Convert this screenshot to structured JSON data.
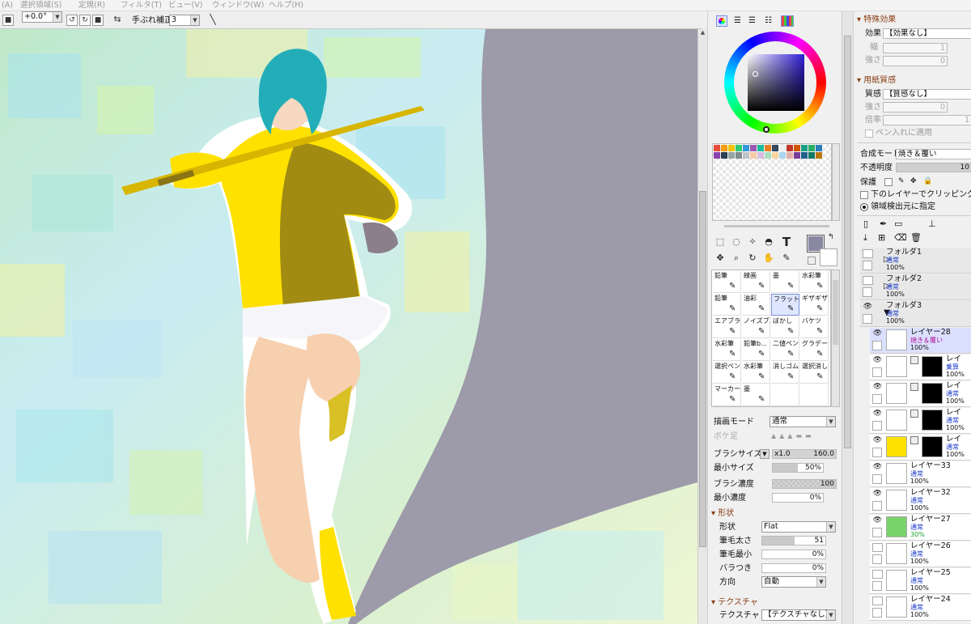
{
  "menu": [
    "(A)",
    "選択領域(S)",
    "定規(R)",
    "フィルタ(T)",
    "ビュー(V)",
    "ウィンドウ(W)",
    "ヘルプ(H)"
  ],
  "toolbar": {
    "angle": "+0.0°",
    "stabilizer_label": "手ぶれ補正",
    "stabilizer_value": "3"
  },
  "color_panel": {
    "palette_colors": [
      "#e74c3c",
      "#f39c12",
      "#f1c40f",
      "#2ecc71",
      "#3498db",
      "#9b59b6",
      "#1abc9c",
      "#e67e22",
      "#34495e",
      "#ecf0f1",
      "#c0392b",
      "#d35400",
      "#16a085",
      "#27ae60",
      "#2980b9",
      "#8e44ad",
      "#2c3e50",
      "#95a5a6",
      "#7f8c8d",
      "#bdc3c7",
      "#f5cba7",
      "#d7bde2",
      "#a9dfbf",
      "#fad7a0",
      "#aed6f1",
      "#e6b0aa",
      "#7d3c98",
      "#1f618d",
      "#117a65",
      "#b9770e"
    ],
    "current_color": "#8a87a3",
    "hue_color": "#2f1dd6"
  },
  "brushes": [
    [
      "鉛筆",
      "線画",
      "墨",
      "水彩筆"
    ],
    [
      "鉛筆",
      "油彩",
      "フラット系",
      "ギザギザ"
    ],
    [
      "エアブラシ",
      "ノイズブ...",
      "ぼかし",
      "バケツ"
    ],
    [
      "水彩筆",
      "鉛筆b...",
      "二値ペン",
      "グラデーション"
    ],
    [
      "選択ペン",
      "水彩筆",
      "消しゴム",
      "選択消し"
    ],
    [
      "マーカー",
      "墨",
      "",
      ""
    ]
  ],
  "brush_settings": {
    "draw_mode_label": "描画モード",
    "draw_mode_value": "通常",
    "blur_label": "ボケ足",
    "size_label": "ブラシサイズ",
    "size_mult": "x1.0",
    "size_value": "160.0",
    "min_size_label": "最小サイズ",
    "min_size_value": "50%",
    "min_size_fraction": 0.5,
    "density_label": "ブラシ濃度",
    "density_value": "100",
    "density_fraction": 1.0,
    "min_density_label": "最小濃度",
    "min_density_value": "0%",
    "min_density_fraction": 0.0,
    "shape_section": "形状",
    "shape_label": "形状",
    "shape_value": "Flat",
    "bristle_width_label": "筆毛太さ",
    "bristle_width_value": "51",
    "bristle_width_fraction": 0.51,
    "bristle_min_label": "筆毛最小",
    "bristle_min_value": "0%",
    "bristle_min_fraction": 0.0,
    "scatter_label": "バラつき",
    "scatter_value": "0%",
    "scatter_fraction": 0.0,
    "direction_label": "方向",
    "direction_value": "自動",
    "texture_section": "テクスチャ",
    "texture_label": "テクスチャ",
    "texture_value": "【テクスチャなし】"
  },
  "effects": {
    "section": "特殊効果",
    "effect_label": "効果",
    "effect_value": "【効果なし】",
    "width_label": "幅",
    "width_value": "1",
    "strength_label": "強さ",
    "strength_value": "0"
  },
  "paper": {
    "section": "用紙質感",
    "texture_label": "質感",
    "texture_value": "【質感なし】",
    "strength_label": "強さ",
    "strength_value": "0",
    "scale_label": "倍率",
    "scale_value": "1",
    "apply_pen": "ペン入れに適用"
  },
  "layer_props": {
    "blend_label": "合成モード",
    "blend_value": "焼き＆覆い",
    "opacity_label": "不透明度",
    "opacity_value": "10",
    "protect_label": "保護",
    "clip_label": "下のレイヤーでクリッピング",
    "sel_source_label": "領域検出元に指定"
  },
  "layers": [
    {
      "name": "フォルダ1",
      "mode": "通常",
      "opacity": "100%",
      "kind": "folder"
    },
    {
      "name": "フォルダ2",
      "mode": "通常",
      "opacity": "100%",
      "kind": "folder"
    },
    {
      "name": "フォルダ3",
      "mode": "通常",
      "opacity": "100%",
      "kind": "folder-open"
    },
    {
      "name": "レイヤー28",
      "mode": "焼き＆覆い",
      "opacity": "100%",
      "kind": "selected"
    },
    {
      "name": "レイ",
      "mode": "乗算",
      "opacity": "100%",
      "kind": "mask"
    },
    {
      "name": "レイ",
      "mode": "通常",
      "opacity": "100%",
      "kind": "mask"
    },
    {
      "name": "レイ",
      "mode": "通常",
      "opacity": "100%",
      "kind": "mask"
    },
    {
      "name": "レイ",
      "mode": "通常",
      "opacity": "100%",
      "kind": "mask-yellow"
    },
    {
      "name": "レイヤー33",
      "mode": "通常",
      "opacity": "100%",
      "kind": "layer"
    },
    {
      "name": "レイヤー32",
      "mode": "通常",
      "opacity": "100%",
      "kind": "layer"
    },
    {
      "name": "レイヤー27",
      "mode": "通常",
      "opacity": "30%",
      "kind": "layer-green"
    },
    {
      "name": "レイヤー26",
      "mode": "通常",
      "opacity": "100%",
      "kind": "layer"
    },
    {
      "name": "レイヤー25",
      "mode": "通常",
      "opacity": "100%",
      "kind": "layer"
    },
    {
      "name": "レイヤー24",
      "mode": "通常",
      "opacity": "100%",
      "kind": "layer"
    }
  ]
}
